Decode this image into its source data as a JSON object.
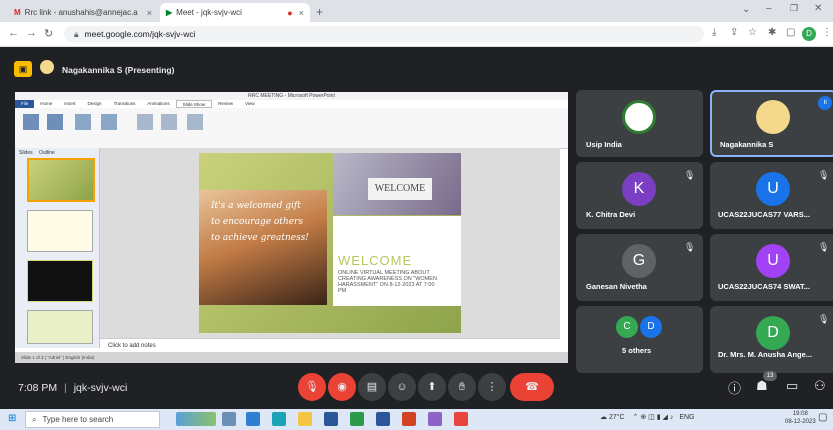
{
  "browser": {
    "tabs": [
      {
        "label": "Rrc link - anushahis@annejac.a",
        "close": "×"
      },
      {
        "label": "Meet - jqk-svjv-wci",
        "close": "×"
      }
    ],
    "new_tab": "+",
    "url": "meet.google.com/jqk-svjv-wci",
    "profile_initial": "D"
  },
  "meet": {
    "presenter_label": "Nagakannika S (Presenting)",
    "meeting_time": "7:08 PM",
    "separator": "|",
    "meeting_code": "jqk-svjv-wci",
    "participant_count": "13",
    "participants": [
      {
        "name": "Usip India",
        "type": "logo"
      },
      {
        "name": "Nagakannika S",
        "type": "photo",
        "active": true
      },
      {
        "name": "K. Chitra Devi",
        "initial": "K",
        "color": "#7b3fc4",
        "muted": true
      },
      {
        "name": "UCAS22JUCAS77 VARS...",
        "initial": "U",
        "color": "#1a73e8",
        "muted": true
      },
      {
        "name": "Ganesan Nivetha",
        "initial": "G",
        "color": "#5f6368",
        "muted": true
      },
      {
        "name": "UCAS22JUCAS74 SWAT...",
        "initial": "U",
        "color": "#a142f4",
        "muted": true
      },
      {
        "name": "5 others",
        "initials": [
          "C",
          "D"
        ],
        "colors": [
          "#34a853",
          "#1a73e8"
        ]
      },
      {
        "name": "Dr. Mrs. M. Anusha Ange...",
        "initial": "D",
        "color": "#34a853",
        "muted": true
      }
    ]
  },
  "ppt": {
    "window_title": "RRC MEETING - Microsoft PowerPoint",
    "menu": [
      "File",
      "Home",
      "Insert",
      "Design",
      "Transitions",
      "Animations",
      "Slide Show",
      "Review",
      "View"
    ],
    "panel_tabs": [
      "Slides",
      "Outline"
    ],
    "notes_placeholder": "Click to add notes",
    "status": "Slide 1 of 3   |   \"Adriel\"   |   English (India)",
    "slide": {
      "quote": "It's a welcomed gift to encourage others to achieve greatness!",
      "welcome_card": "WELCOME",
      "welcome_big": "WELCOME",
      "sub": "ONLINE VIRTUAL MEETING ABOUT CREATING AWARENESS ON \"WOMEN HARASSMENT\" ON 8-12-2023 AT 7:00 PM"
    }
  },
  "taskbar": {
    "search_placeholder": "Type here to search",
    "weather": "27°C",
    "language": "ENG",
    "time": "19:08",
    "date": "08-12-2023"
  }
}
